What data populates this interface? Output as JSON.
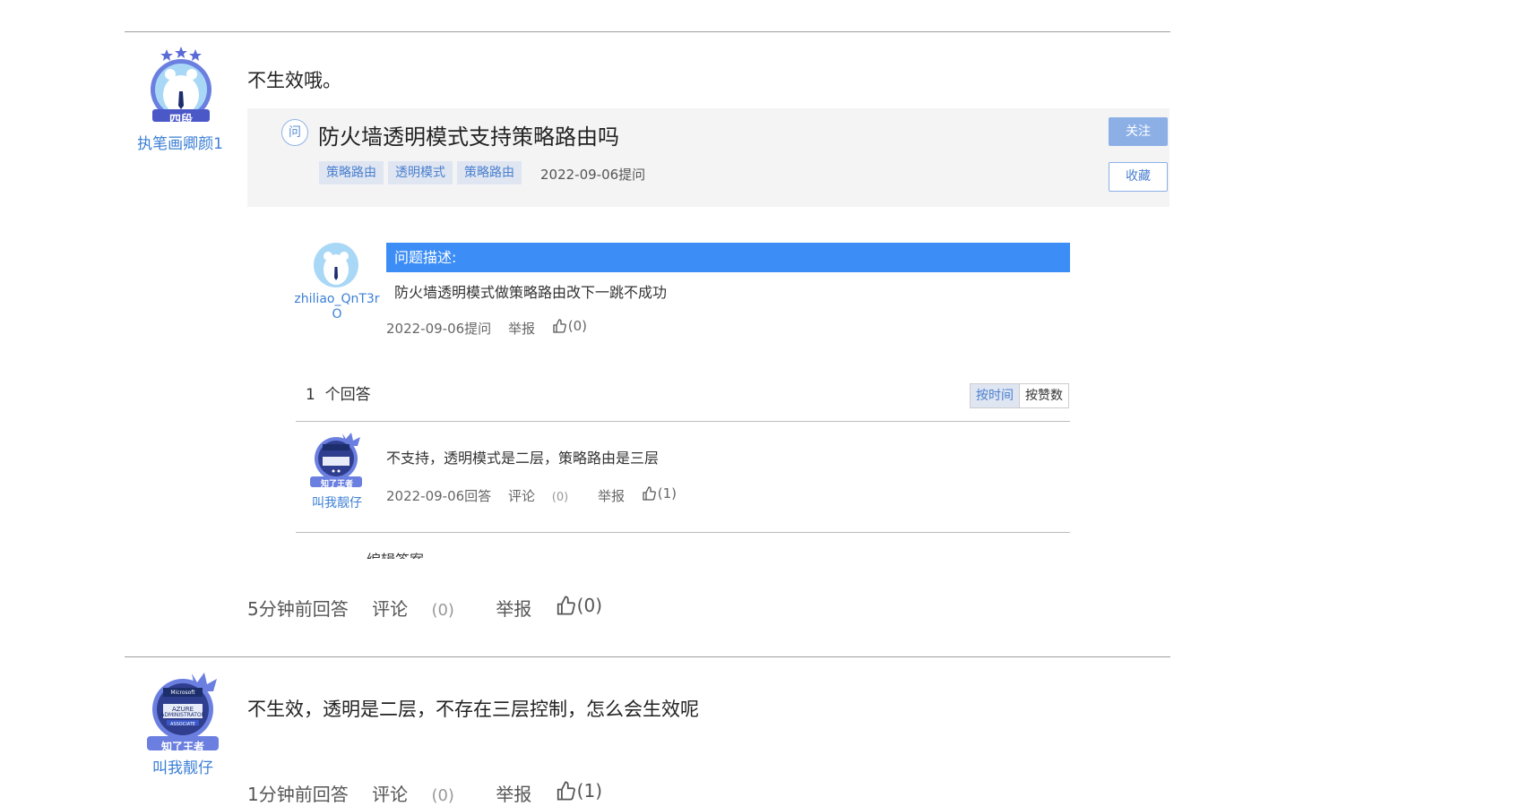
{
  "reply1": {
    "username": "执笔画卿颜1",
    "level_badge": "四段",
    "text": "不生效哦。",
    "time": "5分钟前回答",
    "comment_label": "评论",
    "comment_count": "(0)",
    "report": "举报",
    "likes": "(0)"
  },
  "question_card": {
    "icon_char": "问",
    "title": "防火墙透明模式支持策略路由吗",
    "tags": [
      "策略路由",
      "透明模式",
      "策略路由"
    ],
    "date": "2022-09-06提问",
    "follow_label": "关注",
    "favorite_label": "收藏"
  },
  "question_detail": {
    "asker": "zhiliao_QnT3r",
    "asker_line2": "O",
    "desc_header": "问题描述:",
    "desc_text": "防火墙透明模式做策略路由改下一跳不成功",
    "date": "2022-09-06提问",
    "report": "举报",
    "likes": "(0)"
  },
  "answers_section": {
    "count": "1",
    "count_label": "个回答",
    "sort_time": "按时间",
    "sort_votes": "按赞数"
  },
  "answer1": {
    "username": "叫我靓仔",
    "badge_text": "知了王者",
    "text": "不支持，透明模式是二层，策略路由是三层",
    "date": "2022-09-06回答",
    "comment_label": "评论",
    "comment_count": "(0)",
    "report": "举报",
    "likes": "(1)"
  },
  "clipped_text": "编辑答案",
  "reply2": {
    "username": "叫我靓仔",
    "badge_text": "知了王者",
    "azure_line1": "Microsoft",
    "azure_line2": "AZURE",
    "azure_line3": "ADMINISTRATOR",
    "azure_line4": "ASSOCIATE",
    "text": "不生效，透明是二层，不存在三层控制，怎么会生效呢",
    "time": "1分钟前回答",
    "comment_label": "评论",
    "comment_count": "(0)",
    "report": "举报",
    "likes": "(1)"
  },
  "colors": {
    "accent": "#3c8ef6",
    "link": "#3b7fd6",
    "tag_bg": "#dfe6f2",
    "card_bg": "#f4f4f4"
  }
}
